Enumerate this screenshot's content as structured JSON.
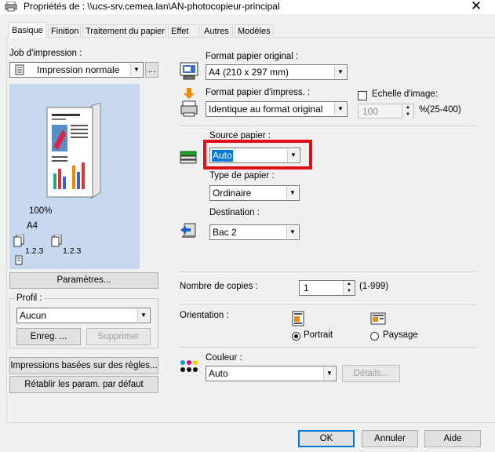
{
  "window": {
    "title": "Propriétés de : \\\\ucs-srv.cemea.lan\\AN-photocopieur-principal",
    "close_glyph": "✕"
  },
  "tabs": [
    {
      "label": "Basique"
    },
    {
      "label": "Finition"
    },
    {
      "label": "Traitement du papier"
    },
    {
      "label": "Effet"
    },
    {
      "label": "Autres"
    },
    {
      "label": "Modèles"
    }
  ],
  "left": {
    "job_label": "Job d'impression :",
    "job_value": "Impression normale",
    "job_more": "...",
    "preview_zoom": "100%",
    "preview_size": "A4",
    "preview_count1": "1.2.3",
    "preview_count2": "1.2.3",
    "settings_button": "Paramètres...",
    "profile_label": "Profil :",
    "profile_value": "Aucun",
    "save_button": "Enreg. ...",
    "delete_button": "Supprimer",
    "rules_button": "Impressions basées sur des règles...",
    "restore_button": "Rétablir les param. par défaut"
  },
  "right": {
    "orig_format_label": "Format papier original :",
    "orig_format_value": "A4 (210 x 297 mm)",
    "print_format_label": "Format papier d'impress. :",
    "print_format_value": "Identique au format original",
    "scale_label": "Echelle d'image:",
    "scale_value": "100",
    "scale_range": "%(25-400)",
    "source_label": "Source papier :",
    "source_value": "Auto",
    "paper_type_label": "Type de papier :",
    "paper_type_value": "Ordinaire",
    "destination_label": "Destination :",
    "destination_value": "Bac 2",
    "copies_label": "Nombre de copies :",
    "copies_value": "1",
    "copies_range": "(1-999)",
    "orientation_label": "Orientation :",
    "portrait_label": "Portrait",
    "landscape_label": "Paysage",
    "orientation_selected": "Portrait",
    "color_label": "Couleur :",
    "color_value": "Auto",
    "details_button": "Détails..."
  },
  "footer": {
    "ok": "OK",
    "cancel": "Annuler",
    "help": "Aide"
  },
  "colors": {
    "highlight": "#e0101a",
    "selection": "#0078d7"
  }
}
